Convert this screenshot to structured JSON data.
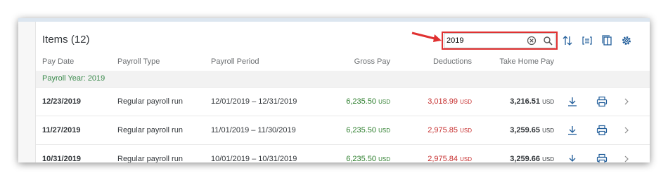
{
  "page": {
    "title": "Items (12)"
  },
  "search": {
    "value": "2019",
    "placeholder": ""
  },
  "toolbar": {
    "icons": [
      "sort-icon",
      "group-icon",
      "columns-icon",
      "settings-icon"
    ]
  },
  "columns": [
    "Pay Date",
    "Payroll Type",
    "Payroll Period",
    "Gross Pay",
    "Deductions",
    "Take Home Pay"
  ],
  "group": {
    "label": "Payroll Year: 2019"
  },
  "rows": [
    {
      "pay_date": "12/23/2019",
      "type": "Regular payroll run",
      "period": "12/01/2019 – 12/31/2019",
      "gross": "6,235.50",
      "deductions": "3,018.99",
      "take_home": "3,216.51",
      "currency": "USD"
    },
    {
      "pay_date": "11/27/2019",
      "type": "Regular payroll run",
      "period": "11/01/2019 – 11/30/2019",
      "gross": "6,235.50",
      "deductions": "2,975.85",
      "take_home": "3,259.65",
      "currency": "USD"
    },
    {
      "pay_date": "10/31/2019",
      "type": "Regular payroll run",
      "period": "10/01/2019 – 10/31/2019",
      "gross": "6,235.50",
      "deductions": "2,975.84",
      "take_home": "3,259.66",
      "currency": "USD"
    }
  ],
  "colors": {
    "gross": "#2b7d2b",
    "deductions": "#c62d2d",
    "group": "#3a8a4c",
    "highlight": "#e03131",
    "icon": "#1f5c99"
  }
}
